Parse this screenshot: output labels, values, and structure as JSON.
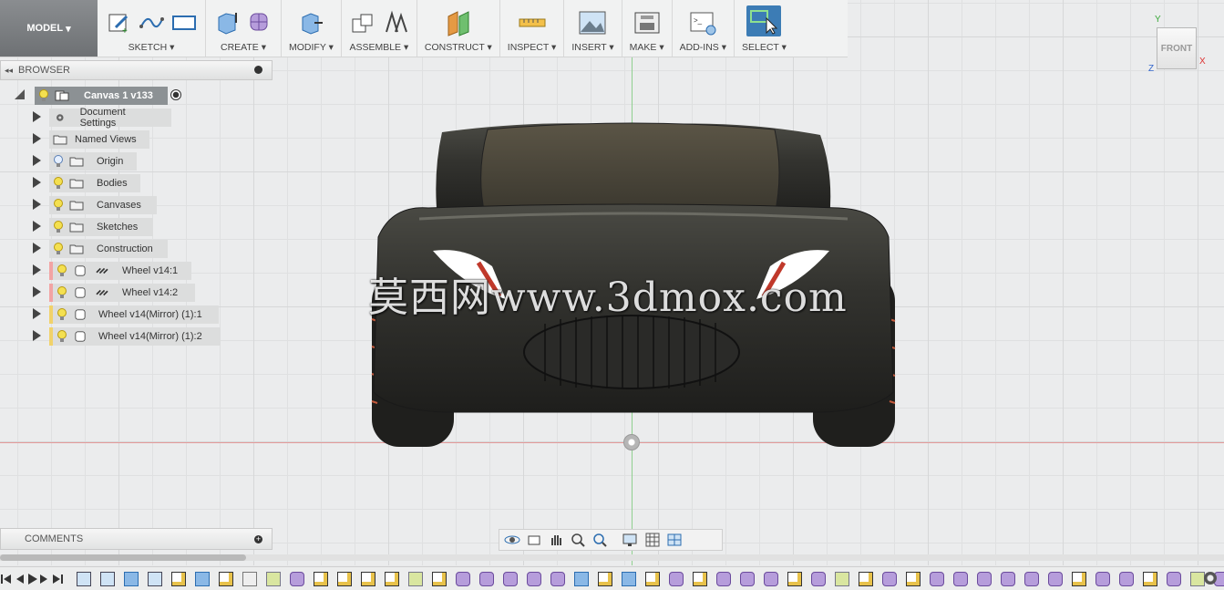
{
  "toolbar": {
    "model_label": "MODEL",
    "groups": [
      {
        "label": "SKETCH"
      },
      {
        "label": "CREATE"
      },
      {
        "label": "MODIFY"
      },
      {
        "label": "ASSEMBLE"
      },
      {
        "label": "CONSTRUCT"
      },
      {
        "label": "INSPECT"
      },
      {
        "label": "INSERT"
      },
      {
        "label": "MAKE"
      },
      {
        "label": "ADD-INS"
      },
      {
        "label": "SELECT"
      }
    ]
  },
  "browser": {
    "title": "BROWSER",
    "root": "Canvas 1 v133",
    "items": [
      {
        "label": "Document Settings",
        "icon": "gear-icon"
      },
      {
        "label": "Named Views",
        "icon": "folder-icon"
      },
      {
        "label": "Origin",
        "icon": "folder-icon"
      },
      {
        "label": "Bodies",
        "icon": "folder-icon"
      },
      {
        "label": "Canvases",
        "icon": "folder-icon"
      },
      {
        "label": "Sketches",
        "icon": "folder-icon"
      },
      {
        "label": "Construction",
        "icon": "folder-icon"
      },
      {
        "label": "Wheel v14:1",
        "icon": "component-link-icon"
      },
      {
        "label": "Wheel v14:2",
        "icon": "component-link-icon"
      },
      {
        "label": "Wheel v14(Mirror) (1):1",
        "icon": "component-icon"
      },
      {
        "label": "Wheel v14(Mirror) (1):2",
        "icon": "component-icon"
      }
    ]
  },
  "comments": {
    "title": "COMMENTS"
  },
  "viewcube": {
    "face": "FRONT",
    "axis_x": "X",
    "axis_y": "Y",
    "axis_z": "Z"
  },
  "watermark": "莫西网www.3dmox.com",
  "colors": {
    "accent": "#3c7cb5",
    "x_axis": "#e49a9a",
    "y_axis": "#8fd08f",
    "body": "#2f2f2c"
  }
}
